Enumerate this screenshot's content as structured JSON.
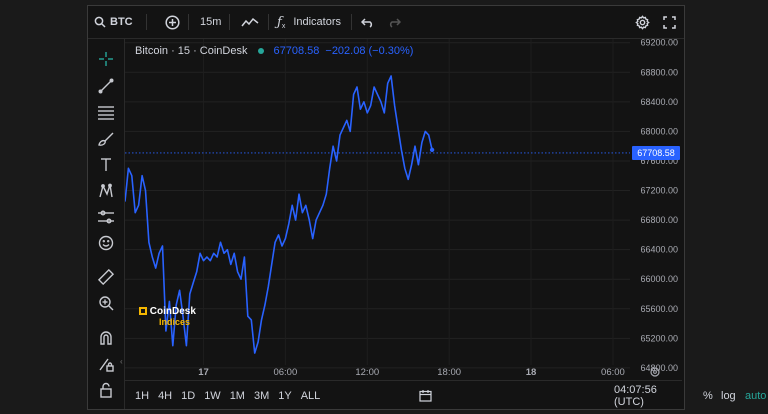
{
  "topbar": {
    "symbol": "BTC",
    "interval": "15m",
    "indicators_label": "Indicators"
  },
  "legend": {
    "title": "Bitcoin · 15 · CoinDesk",
    "price": "67708.58",
    "change": "−202.08 (−0.30%)"
  },
  "price_tag": "67708.58",
  "logo": {
    "line1": "CoinDesk",
    "line2": "Indices"
  },
  "timeframes": [
    "1H",
    "4H",
    "1D",
    "1W",
    "1M",
    "3M",
    "1Y",
    "ALL"
  ],
  "bottom": {
    "time": "04:07:56 (UTC)",
    "percent": "%",
    "log": "log",
    "auto": "auto"
  },
  "colors": {
    "line": "#2962ff",
    "accent": "#2962ff",
    "auto": "#26a69a",
    "background": "#131313"
  },
  "chart_data": {
    "type": "line",
    "title": "Bitcoin · 15 · CoinDesk",
    "y_ticks": [
      69200,
      68800,
      68400,
      68000,
      67600,
      67200,
      66800,
      66400,
      66000,
      65600,
      65200,
      64800
    ],
    "y_tick_labels": [
      "69200.00",
      "68800.00",
      "68400.00",
      "68000.00",
      "67600.00",
      "67200.00",
      "66800.00",
      "66400.00",
      "66000.00",
      "65600.00",
      "65200.00",
      "64800.00"
    ],
    "ylim": [
      64650,
      69250
    ],
    "x_tick_labels": [
      {
        "label": "17",
        "bold": true,
        "t": 6
      },
      {
        "label": "06:00",
        "bold": false,
        "t": 30
      },
      {
        "label": "12:00",
        "bold": false,
        "t": 54
      },
      {
        "label": "18:00",
        "bold": false,
        "t": 78
      },
      {
        "label": "18",
        "bold": true,
        "t": 102
      },
      {
        "label": "06:00",
        "bold": false,
        "t": 126
      }
    ],
    "xlim": [
      -17,
      131
    ],
    "last_price": 67708.58,
    "values": [
      67050,
      67500,
      67400,
      66900,
      67000,
      67400,
      67200,
      66500,
      66300,
      66150,
      66350,
      66450,
      65300,
      65700,
      65100,
      65650,
      65850,
      65500,
      65100,
      65800,
      65950,
      66100,
      66350,
      66250,
      66300,
      66250,
      66350,
      66300,
      66500,
      66350,
      66400,
      66200,
      66350,
      66100,
      66000,
      66300,
      65500,
      65450,
      65000,
      65150,
      65450,
      65650,
      65900,
      66200,
      66500,
      66600,
      66450,
      66550,
      66750,
      67000,
      66800,
      67150,
      66900,
      67000,
      66800,
      66550,
      66800,
      66900,
      67000,
      67150,
      67500,
      67800,
      67600,
      67950,
      68050,
      68150,
      68000,
      68500,
      68600,
      68300,
      68400,
      68250,
      68350,
      68600,
      68500,
      68400,
      68250,
      68650,
      68750,
      68350,
      68050,
      67750,
      67500,
      67350,
      67550,
      67800,
      67550,
      67850,
      68000,
      67950,
      67750
    ]
  }
}
